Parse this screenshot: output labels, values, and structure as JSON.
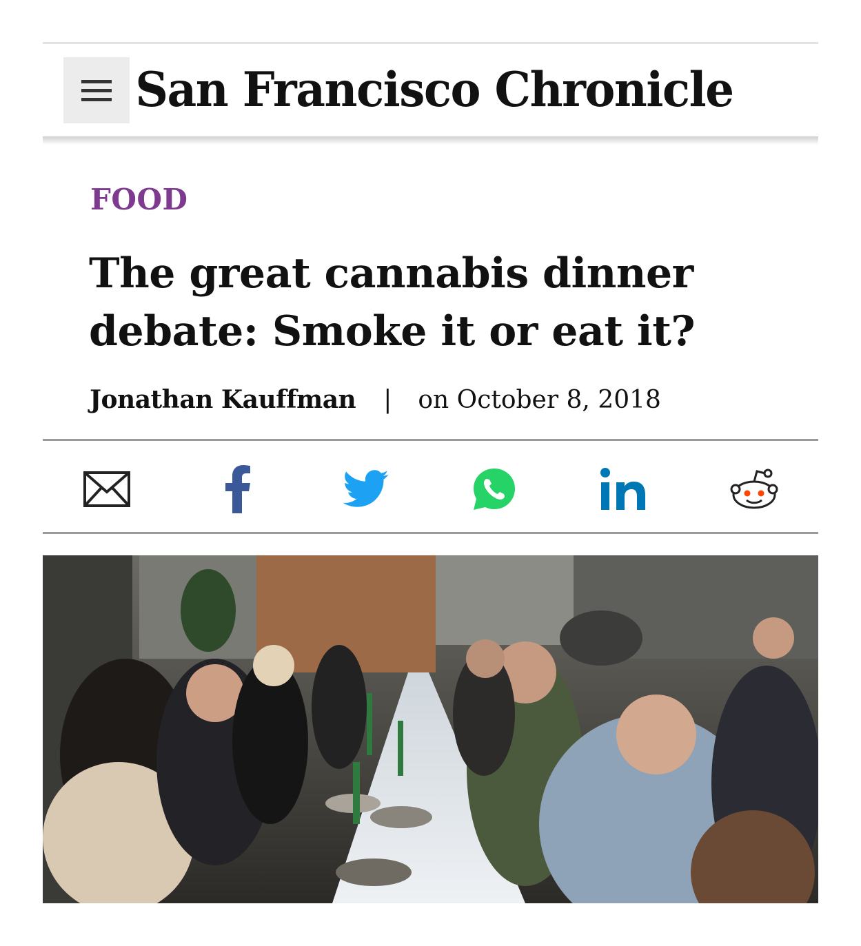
{
  "header": {
    "masthead": "San Francisco Chronicle",
    "menu_icon": "hamburger-menu-icon"
  },
  "article": {
    "section": "FOOD",
    "headline_line1": "The great cannabis dinner",
    "headline_line2": "debate: Smoke it or eat it?",
    "author": "Jonathan Kauffman",
    "separator": "|",
    "date": "on October 8, 2018"
  },
  "share": {
    "buttons": [
      {
        "icon": "email-icon"
      },
      {
        "icon": "facebook-icon",
        "label": "f",
        "color": "#3b5998"
      },
      {
        "icon": "twitter-icon",
        "color": "#1da1f2"
      },
      {
        "icon": "whatsapp-icon",
        "color": "#25d366"
      },
      {
        "icon": "linkedin-icon",
        "label": "in",
        "color": "#0077b5"
      },
      {
        "icon": "reddit-icon",
        "color": "#ff4500"
      }
    ]
  },
  "colors": {
    "section_accent": "#7d3a8e",
    "text": "#111111",
    "rule": "#9a9a9a"
  }
}
